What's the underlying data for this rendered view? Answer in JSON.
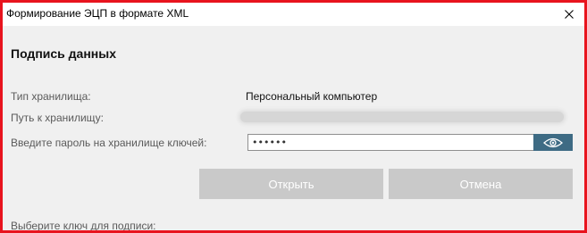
{
  "window": {
    "title": "Формирование ЭЦП в формате XML",
    "frame_color": "#e8141e"
  },
  "section": {
    "title": "Подпись данных"
  },
  "form": {
    "storage_type_label": "Тип хранилища:",
    "storage_type_value": "Персональный компьютер",
    "storage_path_label": "Путь к хранилищу:",
    "password_label": "Введите пароль на хранилище ключей:",
    "password_value": "••••••",
    "select_key_label": "Выберите ключ для подписи:"
  },
  "buttons": {
    "open_label": "Открыть",
    "cancel_label": "Отмена"
  },
  "icons": {
    "close": "close-icon",
    "show_password": "eye-icon"
  },
  "colors": {
    "accent": "#3e6b84",
    "button_disabled": "#c9c9c9"
  }
}
